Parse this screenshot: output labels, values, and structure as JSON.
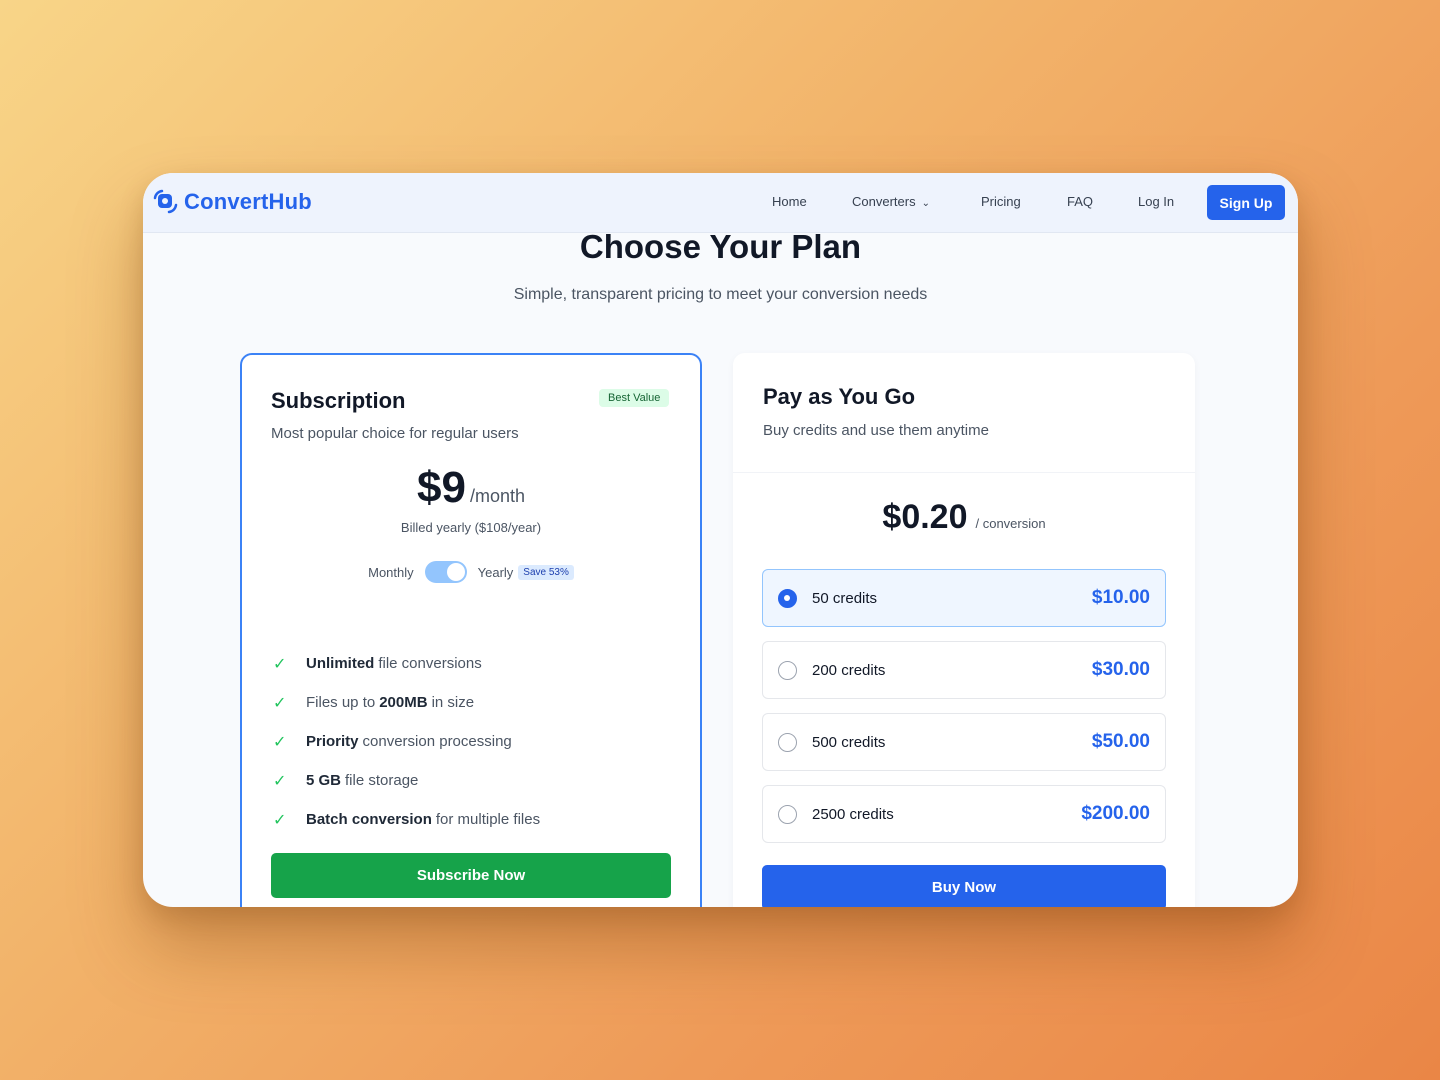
{
  "brand": {
    "name": "ConvertHub",
    "color": "#2563eb"
  },
  "nav": {
    "home": "Home",
    "converters": "Converters",
    "pricing": "Pricing",
    "faq": "FAQ",
    "login": "Log In",
    "signup": "Sign Up"
  },
  "page": {
    "title": "Choose Your Plan",
    "subtitle": "Simple, transparent pricing to meet your conversion needs"
  },
  "subscription": {
    "title": "Subscription",
    "badge": "Best Value",
    "description": "Most popular choice for regular users",
    "price": "$9",
    "price_unit": "/month",
    "billed": "Billed yearly ($108/year)",
    "toggle": {
      "left_label": "Monthly",
      "right_label": "Yearly",
      "save": "Save 53%",
      "yearly_selected": true
    },
    "features": [
      {
        "bold": "Unlimited",
        "rest": "file conversions"
      },
      {
        "pre": "Files up to",
        "bold": "200MB",
        "rest": "in size"
      },
      {
        "bold": "Priority",
        "rest": "conversion processing"
      },
      {
        "bold": "5 GB",
        "rest": "file storage"
      },
      {
        "bold": "Batch conversion",
        "rest": "for multiple files"
      }
    ],
    "button": "Subscribe Now"
  },
  "payg": {
    "title": "Pay as You Go",
    "description": "Buy credits and use them anytime",
    "price": "$0.20",
    "price_unit": "/ conversion",
    "options": [
      {
        "label": "50 credits",
        "price": "$10.00",
        "selected": true
      },
      {
        "label": "200 credits",
        "price": "$30.00",
        "selected": false
      },
      {
        "label": "500 credits",
        "price": "$50.00",
        "selected": false
      },
      {
        "label": "2500 credits",
        "price": "$200.00",
        "selected": false
      }
    ],
    "button": "Buy Now"
  },
  "colors": {
    "primary": "#2563eb",
    "success": "#16a34a",
    "check": "#22c55e"
  }
}
